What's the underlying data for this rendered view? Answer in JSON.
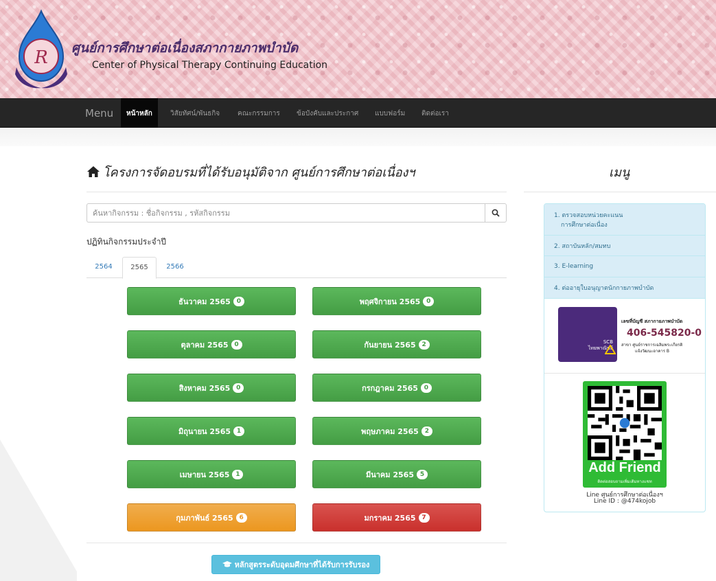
{
  "header": {
    "title_th": "ศูนย์การศึกษาต่อเนื่องสภากายภาพบำบัด",
    "title_en": "Center of Physical Therapy Continuing Education"
  },
  "navbar": {
    "brand": "Menu",
    "items": [
      {
        "label": "หน้าหลัก",
        "active": true
      },
      {
        "label": "วิสัยทัศน์/พันธกิจ"
      },
      {
        "label": "คณะกรรมการ"
      },
      {
        "label": "ข้อบังคับและประกาศ"
      },
      {
        "label": "แบบฟอร์ม"
      },
      {
        "label": "ติดต่อเรา"
      }
    ]
  },
  "main": {
    "heading": "โครงการจัดอบรมที่ได้รับอนุมัติจาก ศูนย์การศึกษาต่อเนื่องฯ",
    "search_placeholder": "ค้นหากิจกรรม : ชื่อกิจกรรม , รหัสกิจกรรม",
    "section_label": "ปฏิทินกิจกรรมประจำปี",
    "tabs": [
      {
        "label": "2564"
      },
      {
        "label": "2565",
        "active": true
      },
      {
        "label": "2566"
      }
    ],
    "months": [
      {
        "label": "ธันวาคม 2565",
        "count": "0",
        "color": "green"
      },
      {
        "label": "พฤศจิกายน 2565",
        "count": "0",
        "color": "green"
      },
      {
        "label": "ตุลาคม 2565",
        "count": "0",
        "color": "green"
      },
      {
        "label": "กันยายน 2565",
        "count": "2",
        "color": "green"
      },
      {
        "label": "สิงหาคม 2565",
        "count": "0",
        "color": "green"
      },
      {
        "label": "กรกฎาคม 2565",
        "count": "0",
        "color": "green"
      },
      {
        "label": "มิถุนายน 2565",
        "count": "1",
        "color": "green"
      },
      {
        "label": "พฤษภาคม 2565",
        "count": "2",
        "color": "green"
      },
      {
        "label": "เมษายน 2565",
        "count": "1",
        "color": "green"
      },
      {
        "label": "มีนาคม 2565",
        "count": "5",
        "color": "green"
      },
      {
        "label": "กุมภาพันธ์ 2565",
        "count": "6",
        "color": "orange"
      },
      {
        "label": "มกราคม 2565",
        "count": "7",
        "color": "red"
      }
    ],
    "bottom_button": "หลักสูตรระดับอุดมศึกษาที่ได้รับการรับรอง"
  },
  "sidebar": {
    "heading": "เมนู",
    "items": [
      {
        "label_line1": "1. ตรวจสอบหน่วยคะแนน",
        "label_line2": "การศึกษาต่อเนื่อง"
      },
      {
        "label_line1": "2. สถาบันหลัก/สมทบ"
      },
      {
        "label_line1": "3. E-learning"
      },
      {
        "label_line1": "4. ต่ออายุใบอนุญาตนักกายภาพบำบัด"
      }
    ],
    "bank": {
      "account_label": "เลขที่บัญชี สภากายภาพบำบัด",
      "account_number": "406-545820-0",
      "branch_line1": "สาขา ศูนย์ราชการเฉลิมพระเกียรติ",
      "branch_line2": "แจ้งวัฒนะอาคาร B",
      "bank_name_en": "SCB",
      "bank_name_th": "ไทยพาณิชย์"
    },
    "line": {
      "add_friend": "Add Friend",
      "add_friend_sub": "ติดต่อสอบถามเพิ่มเติมทางแชท",
      "name": "Line ศูนย์การศึกษาต่อเนื่องฯ",
      "id": "Line ID : @474kojob"
    }
  },
  "colors": {
    "navbar": "#262626",
    "success": "#5cb85c",
    "warning": "#f0ad4e",
    "danger": "#d9534f",
    "info": "#5bc0de",
    "link": "#337ab7",
    "line_green": "#2fbb35"
  }
}
